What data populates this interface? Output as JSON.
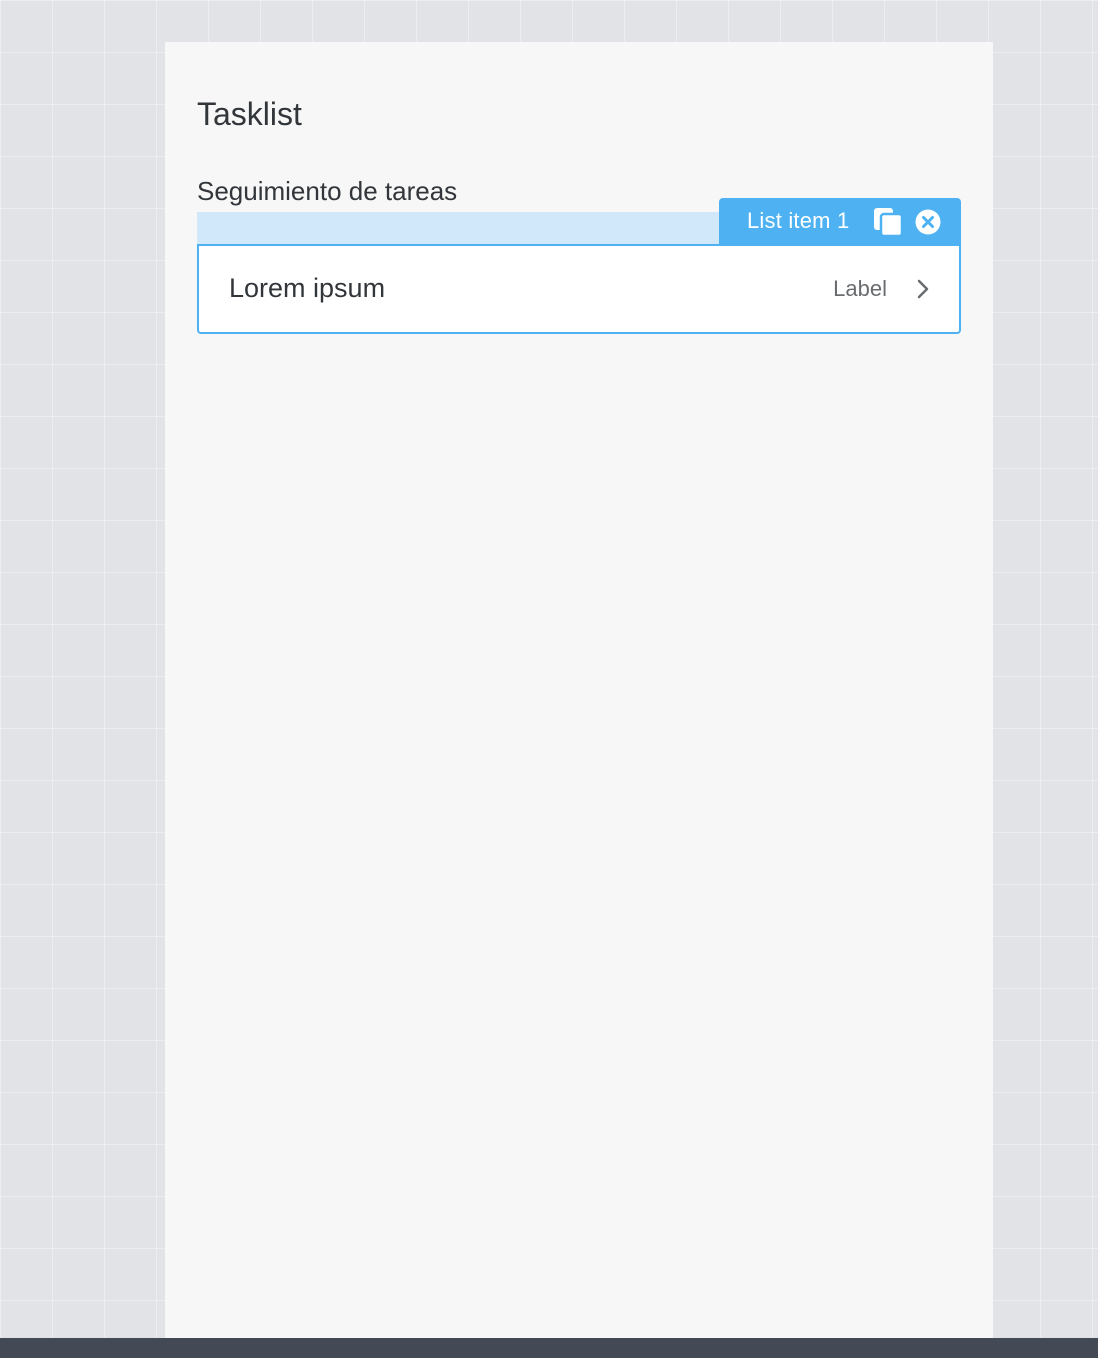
{
  "page": {
    "title": "Tasklist"
  },
  "list": {
    "header": "Seguimiento de tareas",
    "items": [
      {
        "title": "Lorem ipsum",
        "label": "Label"
      }
    ]
  },
  "selection_tag": {
    "label": "List item 1",
    "icons": [
      "copy-icon",
      "close-circle-icon"
    ]
  },
  "colors": {
    "accent": "#4db1f2",
    "selection_band": "#d1e8fa",
    "canvas": "#f7f7f7",
    "background": "#e2e3e6",
    "text": "#32363a",
    "secondary_text": "#6a6d70",
    "bottom_bar": "#434955"
  }
}
